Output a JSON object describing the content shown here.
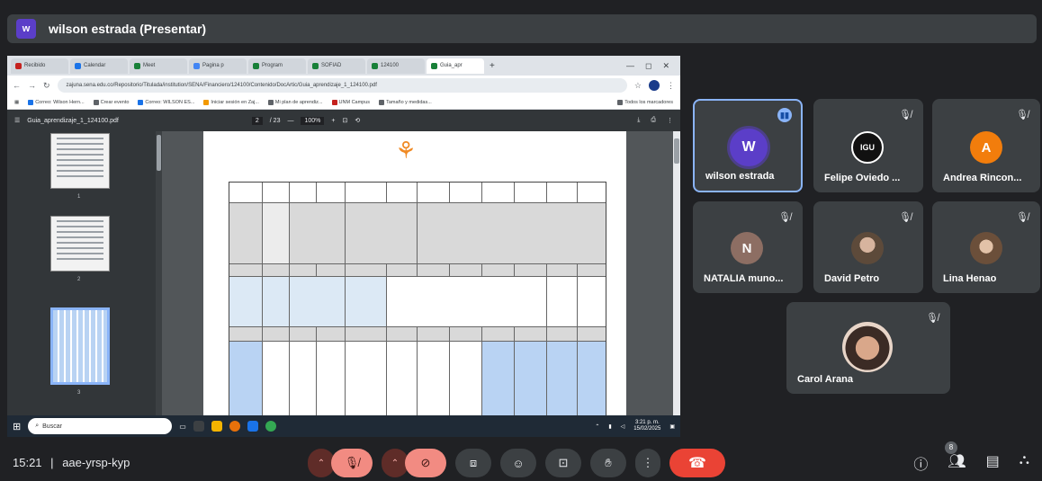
{
  "presenter": {
    "avatar_letter": "w",
    "label": "wilson estrada (Presentar)"
  },
  "browser": {
    "tabs": [
      {
        "label": "Recibido",
        "color": "#c5221f"
      },
      {
        "label": "Calendar",
        "color": "#1a73e8"
      },
      {
        "label": "Meet",
        "color": "#188038"
      },
      {
        "label": "Pagina p",
        "color": "#4285f4"
      },
      {
        "label": "Program",
        "color": "#188038"
      },
      {
        "label": "SOFIAD",
        "color": "#188038"
      },
      {
        "label": "124100",
        "color": "#188038"
      },
      {
        "label": "Guia_apr",
        "color": "#188038"
      }
    ],
    "url": "zajuna.sena.edu.co/Repositorio/Titulada/institution/SENA/Financiero/124100/Contenido/DocArtic/Guia_aprendizaje_1_124100.pdf",
    "bookmarks": [
      "Correo: Wilson Hern...",
      "Crear evento",
      "Correo: WILSON ES...",
      "Iniciar sesión en Zaj...",
      "Mi plan de aprendiz...",
      "UNM Campus",
      "Tamaño y medidas...",
      "Todos los marcadores"
    ]
  },
  "pdf": {
    "filename": "Guia_aprendizaje_1_124100.pdf",
    "page_box": "2",
    "page_total": "/ 23",
    "zoom": "100%",
    "thumb_numbers": [
      "1",
      "2",
      "3"
    ]
  },
  "taskbar": {
    "search_placeholder": "Buscar",
    "time": "3:21 p. m.",
    "date": "15/02/2025"
  },
  "participants": [
    {
      "name": "wilson estrada",
      "initial": "W",
      "avatar_color": "#5b3ec8",
      "speaking": true
    },
    {
      "name": "Felipe Oviedo ...",
      "initial": "IGU",
      "avatar_color": "#111111",
      "muted": true
    },
    {
      "name": "Andrea Rincon...",
      "initial": "A",
      "avatar_color": "#f27d0c",
      "muted": true
    },
    {
      "name": "NATALIA muno...",
      "initial": "N",
      "avatar_color": "#8d6e63",
      "muted": true
    },
    {
      "name": "David Petro",
      "initial": "",
      "avatar_color": "#5d4a3a",
      "muted": true
    },
    {
      "name": "Lina Henao",
      "initial": "",
      "avatar_color": "#6b4f3a",
      "muted": true
    },
    {
      "name": "Carol Arana",
      "initial": "",
      "avatar_color": "#e8d5c8",
      "muted": true
    }
  ],
  "meeting": {
    "time": "15:21",
    "separator": "|",
    "code": "aae-yrsp-kyp",
    "participant_count": "8"
  }
}
